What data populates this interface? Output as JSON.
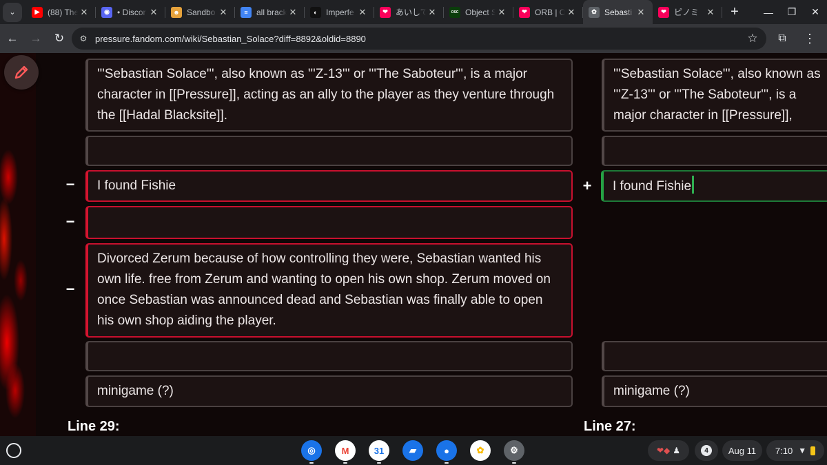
{
  "browser": {
    "tabs": [
      {
        "title": "(88) The",
        "favicon": "youtube-icon",
        "color": "#ff0000",
        "glyph": "▶"
      },
      {
        "title": "• Discor",
        "favicon": "discord-icon",
        "color": "#5865f2",
        "glyph": "◉"
      },
      {
        "title": "Sandbo",
        "favicon": "sandbox-avatar-icon",
        "color": "#e6a23c",
        "glyph": "☻"
      },
      {
        "title": "all brack",
        "favicon": "google-docs-icon",
        "color": "#4285f4",
        "glyph": "≡"
      },
      {
        "title": "Imperfe",
        "favicon": "imperfect-site-icon",
        "color": "#111111",
        "glyph": "◐"
      },
      {
        "title": "あいして",
        "favicon": "fandom-icon",
        "color": "#fa005a",
        "glyph": "❤"
      },
      {
        "title": "Object S",
        "favicon": "osc-wiki-icon",
        "color": "#0b3d0b",
        "glyph": "OSC"
      },
      {
        "title": "ORB | Ot",
        "favicon": "fandom-icon",
        "color": "#fa005a",
        "glyph": "❤"
      },
      {
        "title": "Sebasti",
        "favicon": "wiki-globe-icon",
        "color": "#5f6368",
        "glyph": "✿",
        "active": true
      },
      {
        "title": "ピノミ",
        "favicon": "fandom-icon",
        "color": "#fa005a",
        "glyph": "❤"
      }
    ],
    "url": "pressure.fandom.com/wiki/Sebastian_Solace?diff=8892&oldid=8890"
  },
  "diff": {
    "left": {
      "intro": "'''Sebastian Solace''', also known as '''Z-13''' or '''The Saboteur''', is a major character in [[Pressure]], acting as an ally to the player as they venture through the [[Hadal Blacksite]].",
      "empty1": "",
      "deleted1": "I found Fishie",
      "deleted2": "",
      "deleted3": "Divorced Zerum because of how controlling they were, Sebastian wanted his own life. free from Zerum and wanting to open his own shop. Zerum moved on once Sebastian was announced dead and Sebastian was finally able to open his own shop aiding the player.",
      "empty2": "",
      "minigame": "minigame (?)",
      "line_header": "Line 29:"
    },
    "right": {
      "intro": "'''Sebastian Solace''', also known as '''Z-13''' or '''The Saboteur''', is a major character in [[Pressure]], acting as an ally to the player as they venture through the [[Hadal Blacksite]].",
      "empty1": "",
      "added1": "I found Fishie",
      "empty2": "",
      "minigame": "minigame (?)",
      "line_header": "Line 27:"
    },
    "minus_marker": "−",
    "plus_marker": "+"
  },
  "shelf": {
    "apps": [
      {
        "name": "chrome-app-icon",
        "color": "#1a73e8",
        "glyph": "◎"
      },
      {
        "name": "gmail-app-icon",
        "color": "#ffffff",
        "glyph": "M",
        "fg": "#ea4335"
      },
      {
        "name": "calendar-app-icon",
        "color": "#ffffff",
        "glyph": "31",
        "fg": "#1a73e8"
      },
      {
        "name": "files-app-icon",
        "color": "#1a73e8",
        "glyph": "▰"
      },
      {
        "name": "messages-app-icon",
        "color": "#1a73e8",
        "glyph": "●"
      },
      {
        "name": "photos-app-icon",
        "color": "#ffffff",
        "glyph": "✿",
        "fg": "#fbbc04"
      },
      {
        "name": "settings-app-icon",
        "color": "#5f6368",
        "glyph": "⚙"
      }
    ],
    "notification_count": "4",
    "date": "Aug 11",
    "time": "7:10"
  },
  "colors": {
    "deleted_border": "#d4142f",
    "added_border": "#25a244",
    "page_bg": "#0f0707"
  }
}
